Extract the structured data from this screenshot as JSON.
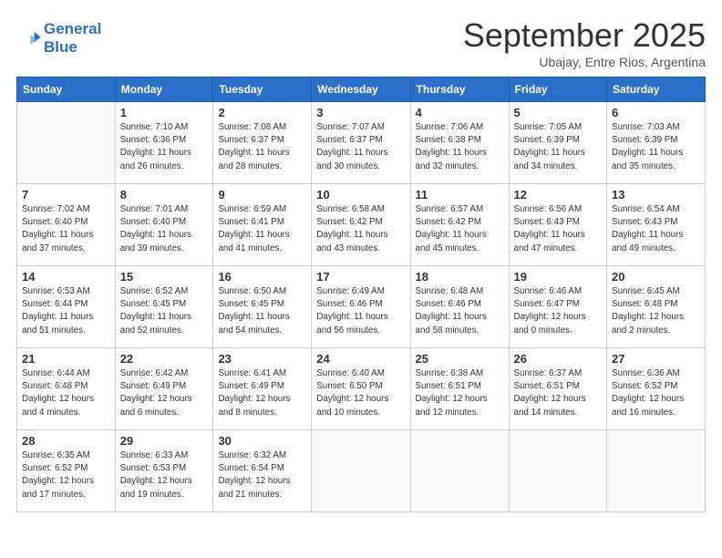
{
  "logo": {
    "line1": "General",
    "line2": "Blue"
  },
  "title": "September 2025",
  "subtitle": "Ubajay, Entre Rios, Argentina",
  "days_of_week": [
    "Sunday",
    "Monday",
    "Tuesday",
    "Wednesday",
    "Thursday",
    "Friday",
    "Saturday"
  ],
  "weeks": [
    [
      {
        "num": "",
        "info": ""
      },
      {
        "num": "1",
        "info": "Sunrise: 7:10 AM\nSunset: 6:36 PM\nDaylight: 11 hours\nand 26 minutes."
      },
      {
        "num": "2",
        "info": "Sunrise: 7:08 AM\nSunset: 6:37 PM\nDaylight: 11 hours\nand 28 minutes."
      },
      {
        "num": "3",
        "info": "Sunrise: 7:07 AM\nSunset: 6:37 PM\nDaylight: 11 hours\nand 30 minutes."
      },
      {
        "num": "4",
        "info": "Sunrise: 7:06 AM\nSunset: 6:38 PM\nDaylight: 11 hours\nand 32 minutes."
      },
      {
        "num": "5",
        "info": "Sunrise: 7:05 AM\nSunset: 6:39 PM\nDaylight: 11 hours\nand 34 minutes."
      },
      {
        "num": "6",
        "info": "Sunrise: 7:03 AM\nSunset: 6:39 PM\nDaylight: 11 hours\nand 35 minutes."
      }
    ],
    [
      {
        "num": "7",
        "info": "Sunrise: 7:02 AM\nSunset: 6:40 PM\nDaylight: 11 hours\nand 37 minutes."
      },
      {
        "num": "8",
        "info": "Sunrise: 7:01 AM\nSunset: 6:40 PM\nDaylight: 11 hours\nand 39 minutes."
      },
      {
        "num": "9",
        "info": "Sunrise: 6:59 AM\nSunset: 6:41 PM\nDaylight: 11 hours\nand 41 minutes."
      },
      {
        "num": "10",
        "info": "Sunrise: 6:58 AM\nSunset: 6:42 PM\nDaylight: 11 hours\nand 43 minutes."
      },
      {
        "num": "11",
        "info": "Sunrise: 6:57 AM\nSunset: 6:42 PM\nDaylight: 11 hours\nand 45 minutes."
      },
      {
        "num": "12",
        "info": "Sunrise: 6:56 AM\nSunset: 6:43 PM\nDaylight: 11 hours\nand 47 minutes."
      },
      {
        "num": "13",
        "info": "Sunrise: 6:54 AM\nSunset: 6:43 PM\nDaylight: 11 hours\nand 49 minutes."
      }
    ],
    [
      {
        "num": "14",
        "info": "Sunrise: 6:53 AM\nSunset: 6:44 PM\nDaylight: 11 hours\nand 51 minutes."
      },
      {
        "num": "15",
        "info": "Sunrise: 6:52 AM\nSunset: 6:45 PM\nDaylight: 11 hours\nand 52 minutes."
      },
      {
        "num": "16",
        "info": "Sunrise: 6:50 AM\nSunset: 6:45 PM\nDaylight: 11 hours\nand 54 minutes."
      },
      {
        "num": "17",
        "info": "Sunrise: 6:49 AM\nSunset: 6:46 PM\nDaylight: 11 hours\nand 56 minutes."
      },
      {
        "num": "18",
        "info": "Sunrise: 6:48 AM\nSunset: 6:46 PM\nDaylight: 11 hours\nand 58 minutes."
      },
      {
        "num": "19",
        "info": "Sunrise: 6:46 AM\nSunset: 6:47 PM\nDaylight: 12 hours\nand 0 minutes."
      },
      {
        "num": "20",
        "info": "Sunrise: 6:45 AM\nSunset: 6:48 PM\nDaylight: 12 hours\nand 2 minutes."
      }
    ],
    [
      {
        "num": "21",
        "info": "Sunrise: 6:44 AM\nSunset: 6:48 PM\nDaylight: 12 hours\nand 4 minutes."
      },
      {
        "num": "22",
        "info": "Sunrise: 6:42 AM\nSunset: 6:49 PM\nDaylight: 12 hours\nand 6 minutes."
      },
      {
        "num": "23",
        "info": "Sunrise: 6:41 AM\nSunset: 6:49 PM\nDaylight: 12 hours\nand 8 minutes."
      },
      {
        "num": "24",
        "info": "Sunrise: 6:40 AM\nSunset: 6:50 PM\nDaylight: 12 hours\nand 10 minutes."
      },
      {
        "num": "25",
        "info": "Sunrise: 6:38 AM\nSunset: 6:51 PM\nDaylight: 12 hours\nand 12 minutes."
      },
      {
        "num": "26",
        "info": "Sunrise: 6:37 AM\nSunset: 6:51 PM\nDaylight: 12 hours\nand 14 minutes."
      },
      {
        "num": "27",
        "info": "Sunrise: 6:36 AM\nSunset: 6:52 PM\nDaylight: 12 hours\nand 16 minutes."
      }
    ],
    [
      {
        "num": "28",
        "info": "Sunrise: 6:35 AM\nSunset: 6:52 PM\nDaylight: 12 hours\nand 17 minutes."
      },
      {
        "num": "29",
        "info": "Sunrise: 6:33 AM\nSunset: 6:53 PM\nDaylight: 12 hours\nand 19 minutes."
      },
      {
        "num": "30",
        "info": "Sunrise: 6:32 AM\nSunset: 6:54 PM\nDaylight: 12 hours\nand 21 minutes."
      },
      {
        "num": "",
        "info": ""
      },
      {
        "num": "",
        "info": ""
      },
      {
        "num": "",
        "info": ""
      },
      {
        "num": "",
        "info": ""
      }
    ]
  ]
}
